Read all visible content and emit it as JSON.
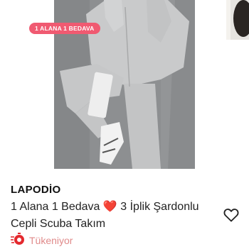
{
  "product": {
    "badge": "1 ALANA 1 BEDAVA",
    "brand": "LAPODİO",
    "title_part1": "1 Alana 1 Bedava",
    "title_heart": "❤️",
    "title_part2": "3 İplik Şardonlu Cepli Scuba Takım",
    "stock_status": "Tükeniyor"
  },
  "colors": {
    "badge_bg": "#f05a71",
    "stock_text": "#e08a8a",
    "heart": "#e4292e"
  },
  "icons": {
    "favorite": "heart-outline-icon",
    "stock": "stopwatch-icon"
  }
}
